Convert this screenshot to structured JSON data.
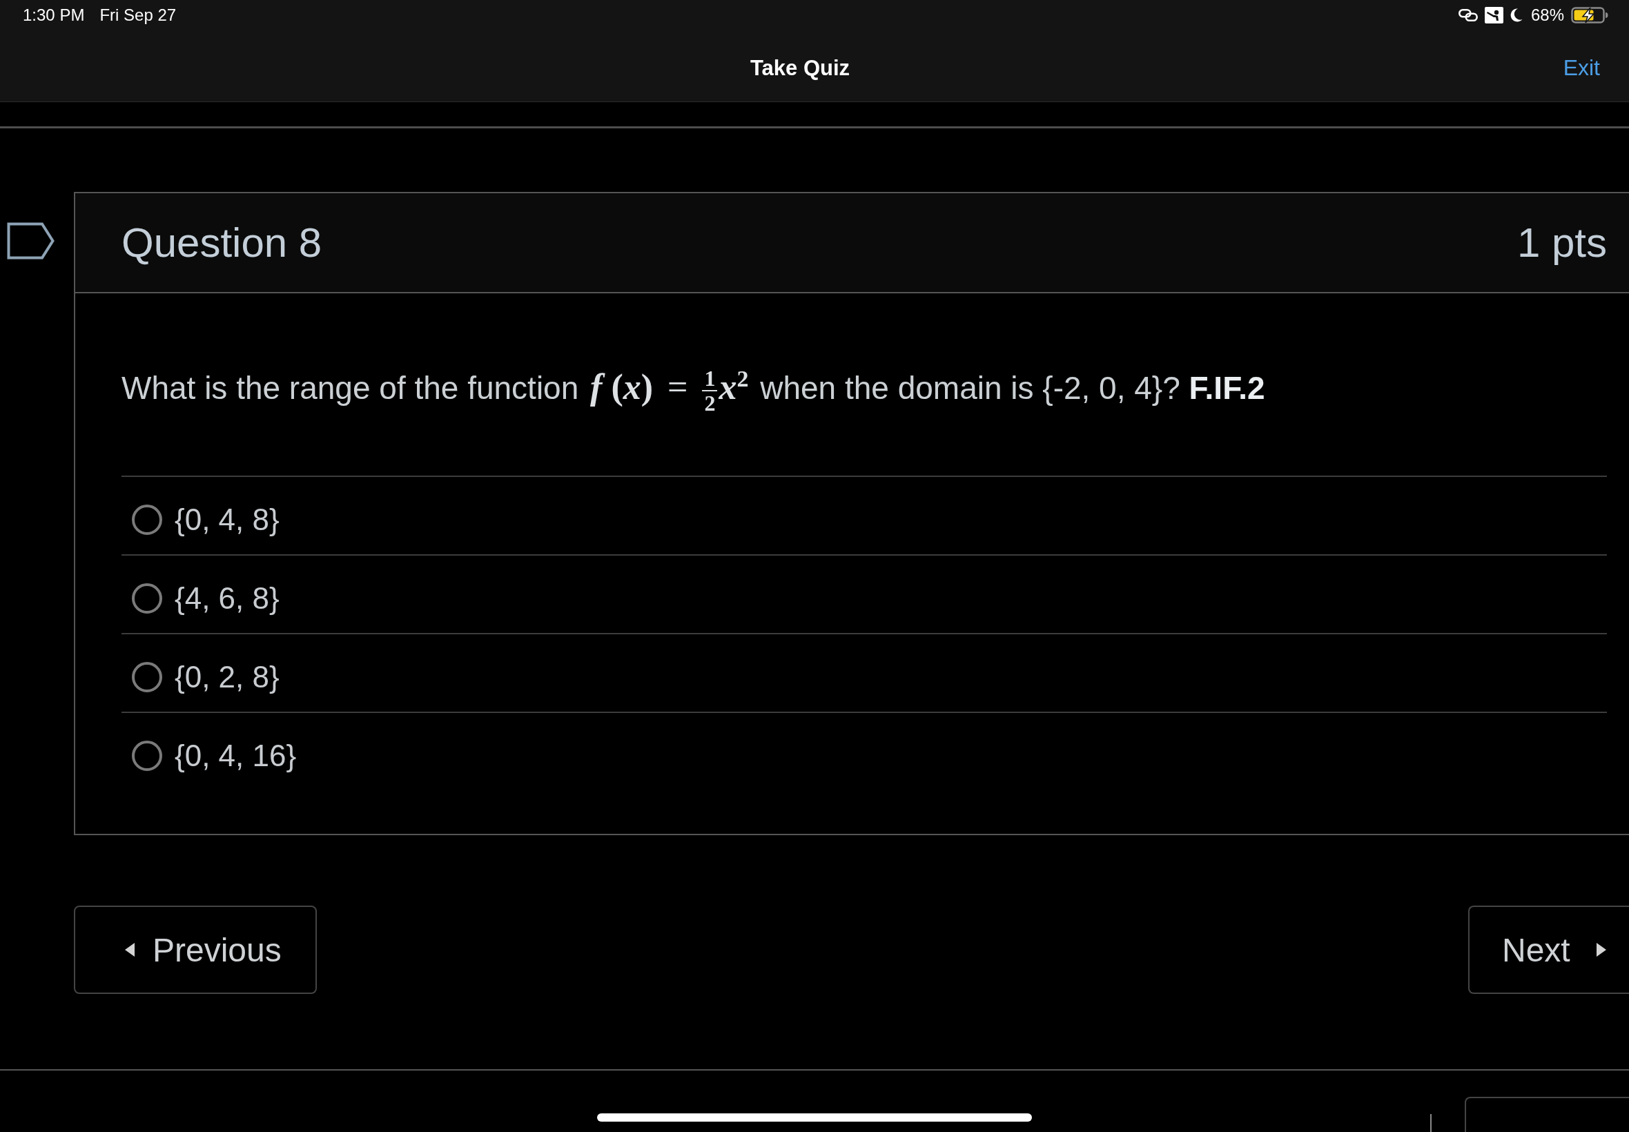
{
  "status_bar": {
    "time": "1:30 PM",
    "date": "Fri Sep 27",
    "battery": "68%"
  },
  "header": {
    "title": "Take Quiz",
    "exit": "Exit"
  },
  "question": {
    "title": "Question 8",
    "points": "1 pts",
    "flagged": false,
    "text_before": "What is the range of the function",
    "formula": {
      "lhs": "*f* (*x*)",
      "relation": "=",
      "numerator": "1",
      "denominator": "2",
      "rhs": "*x*$^{2}$"
    },
    "text_after": "when the domain is {-2, 0, 4}? **F.IF.2**",
    "answers": [
      {
        "label": "{0, 4, 8}",
        "selected": false
      },
      {
        "label": "{4, 6, 8}",
        "selected": false
      },
      {
        "label": "{0, 2, 8}",
        "selected": false
      },
      {
        "label": "{0, 4, 16}",
        "selected": false
      }
    ]
  },
  "navigation": {
    "previous": "Previous",
    "next": "Next"
  }
}
